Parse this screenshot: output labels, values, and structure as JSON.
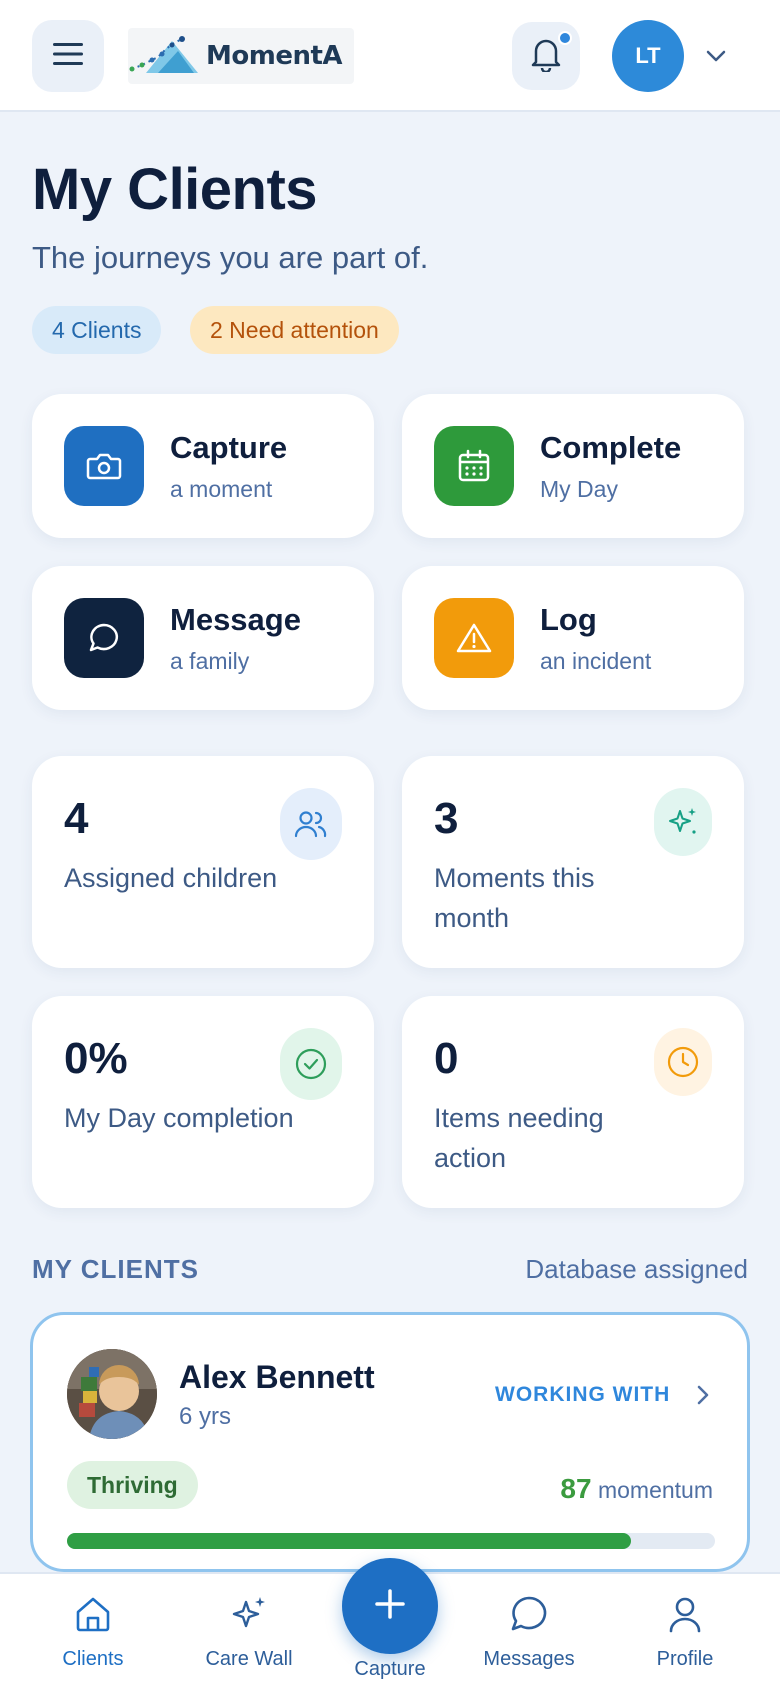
{
  "header": {
    "logo_text": "MomentA",
    "avatar_initials": "LT",
    "notification_dot": true
  },
  "title": "My Clients",
  "subtitle": "The journeys you are part of.",
  "pills": {
    "clients": "4 Clients",
    "attention": "2 Need attention"
  },
  "actions": [
    {
      "title": "Capture",
      "sub": "a moment",
      "icon": "camera-icon",
      "color": "#1f6fc1"
    },
    {
      "title": "Complete",
      "sub": "My Day",
      "icon": "calendar-icon",
      "color": "#2e9a3b"
    },
    {
      "title": "Message",
      "sub": "a family",
      "icon": "chat-bubble-icon",
      "color": "#0f233f"
    },
    {
      "title": "Log",
      "sub": "an incident",
      "icon": "warning-icon",
      "color": "#f29b0b"
    }
  ],
  "stats": [
    {
      "value": "4",
      "label": "Assigned children",
      "icon": "users-icon"
    },
    {
      "value": "3",
      "label": "Moments this month",
      "icon": "sparkle-icon"
    },
    {
      "value": "0%",
      "label": "My Day completion",
      "icon": "check-circle-icon"
    },
    {
      "value": "0",
      "label": "Items needing action",
      "icon": "clock-icon"
    }
  ],
  "section": {
    "title": "MY CLIENTS",
    "link": "Database assigned"
  },
  "client": {
    "name": "Alex Bennett",
    "age": "6 yrs",
    "status": "WORKING WITH",
    "badge": "Thriving",
    "momentum_value": "87",
    "momentum_label": "momentum",
    "progress": 0.87
  },
  "nav": {
    "clients": "Clients",
    "care_wall": "Care Wall",
    "capture": "Capture",
    "messages": "Messages",
    "profile": "Profile",
    "active": "Clients"
  }
}
